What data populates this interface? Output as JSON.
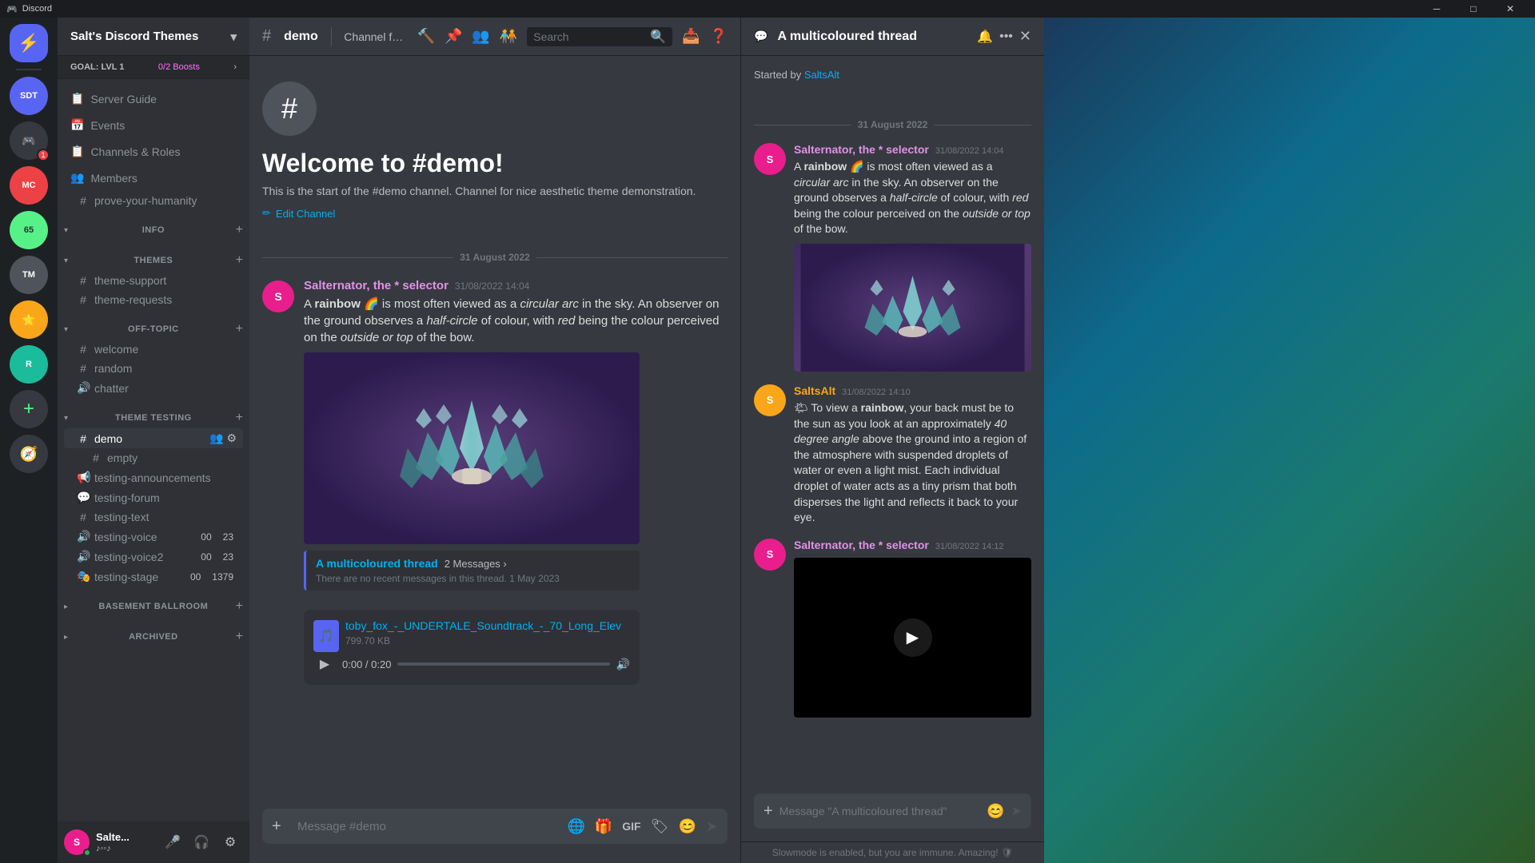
{
  "titlebar": {
    "app_name": "Discord",
    "controls": [
      "minimize",
      "maximize",
      "close"
    ]
  },
  "server": {
    "name": "Salt's Discord Themes",
    "boost_goal": "GOAL: LVL 1",
    "boost_count": "0/2 Boosts"
  },
  "sidebar": {
    "nav_items": [
      {
        "id": "server-guide",
        "icon": "📋",
        "label": "Server Guide"
      },
      {
        "id": "events",
        "icon": "📅",
        "label": "Events"
      },
      {
        "id": "channels-roles",
        "icon": "📋",
        "label": "Channels & Roles"
      },
      {
        "id": "members",
        "icon": "👥",
        "label": "Members"
      }
    ],
    "special_channels": [
      {
        "id": "prove-humanity",
        "icon": "#",
        "label": "prove-your-humanity",
        "type": "text"
      }
    ],
    "categories": [
      {
        "id": "info",
        "name": "INFO",
        "collapsed": false,
        "channels": []
      },
      {
        "id": "themes",
        "name": "THEMES",
        "collapsed": false,
        "channels": [
          {
            "id": "theme-support",
            "icon": "#",
            "label": "theme-support",
            "type": "text"
          },
          {
            "id": "theme-requests",
            "icon": "#",
            "label": "theme-requests",
            "type": "text"
          }
        ]
      },
      {
        "id": "off-topic",
        "name": "OFF-TOPIC",
        "collapsed": false,
        "channels": [
          {
            "id": "welcome",
            "icon": "#",
            "label": "welcome",
            "type": "text"
          },
          {
            "id": "random",
            "icon": "#",
            "label": "random",
            "type": "text"
          },
          {
            "id": "chatter",
            "icon": "🔊",
            "label": "chatter",
            "type": "voice"
          }
        ]
      },
      {
        "id": "theme-testing",
        "name": "THEME TESTING",
        "collapsed": false,
        "channels": [
          {
            "id": "demo",
            "icon": "#",
            "label": "demo",
            "type": "text",
            "active": true
          },
          {
            "id": "empty",
            "icon": "#",
            "label": "empty",
            "type": "text"
          },
          {
            "id": "testing-announcements",
            "icon": "📢",
            "label": "testing-announcements",
            "type": "announcement"
          },
          {
            "id": "testing-forum",
            "icon": "💬",
            "label": "testing-forum",
            "type": "forum"
          },
          {
            "id": "testing-text",
            "icon": "#",
            "label": "testing-text",
            "type": "text"
          },
          {
            "id": "testing-voice",
            "icon": "🔊",
            "label": "testing-voice",
            "type": "voice",
            "count1": "00",
            "count2": "23"
          },
          {
            "id": "testing-voice2",
            "icon": "🔊",
            "label": "testing-voice2",
            "type": "voice",
            "count1": "00",
            "count2": "23"
          },
          {
            "id": "testing-stage",
            "icon": "🎭",
            "label": "testing-stage",
            "type": "stage",
            "count1": "00",
            "count2": "1379"
          }
        ]
      },
      {
        "id": "basement-ballroom",
        "name": "BASEMENT BALLROOM",
        "collapsed": false,
        "channels": []
      },
      {
        "id": "archived",
        "name": "ARCHIVED",
        "collapsed": false,
        "channels": []
      }
    ]
  },
  "current_channel": {
    "name": "demo",
    "topic": "Channel for nice aesthe...",
    "welcome_title": "Welcome to #demo!",
    "welcome_desc": "This is the start of the #demo channel. Channel for nice aesthetic theme demonstration.",
    "edit_channel": "Edit Channel"
  },
  "messages": [
    {
      "id": "msg1",
      "author": "Salternator, the * selector",
      "author_color": "purple",
      "timestamp": "31/08/2022 14:04",
      "avatar_initials": "S",
      "avatar_color": "pink",
      "text_parts": [
        {
          "type": "text",
          "content": "A "
        },
        {
          "type": "bold",
          "content": "rainbow"
        },
        {
          "type": "text",
          "content": " 🌈 is most often viewed as a "
        },
        {
          "type": "italic",
          "content": "circular arc"
        },
        {
          "type": "text",
          "content": " in the sky. An observer on the ground observes a "
        },
        {
          "type": "italic",
          "content": "half-circle"
        },
        {
          "type": "text",
          "content": " of colour, with "
        },
        {
          "type": "italic",
          "content": "red"
        },
        {
          "type": "text",
          "content": " being the colour perceived on the "
        },
        {
          "type": "italic",
          "content": "outside or top"
        },
        {
          "type": "text",
          "content": " of the bow."
        }
      ],
      "has_image": true,
      "has_thread": true,
      "thread_name": "A multicoloured thread",
      "thread_messages": "2 Messages ›",
      "thread_last": "There are no recent messages in this thread. 1 May 2023"
    },
    {
      "id": "msg2",
      "author": "Salternator, the * selector",
      "author_color": "purple",
      "timestamp": "31/08/2022 14:04",
      "is_continuation": true,
      "has_audio": true,
      "audio_filename": "toby_fox_-_UNDERTALE_Soundtrack_-_70_Long_Elev",
      "audio_filesize": "799.70 KB",
      "audio_time": "0:00 / 0:20"
    }
  ],
  "input": {
    "placeholder": "Message #demo",
    "thread_placeholder": "Message \"A multicoloured thread\""
  },
  "user": {
    "name": "Salte...",
    "discriminator": "♪◦◦♪",
    "avatar_initials": "S",
    "avatar_color": "pink"
  },
  "thread_panel": {
    "title": "A multicoloured thread",
    "started_by": "Started by",
    "started_by_user": "SaltsAlt",
    "date": "31 August 2022",
    "messages": [
      {
        "id": "tm1",
        "author": "Salternator, the * selector",
        "author_color": "purple",
        "timestamp": "31/08/2022 14:04",
        "avatar_initials": "S",
        "avatar_color": "pink",
        "text": "A rainbow 🌈 is most often viewed as a circular arc in the sky. An observer on the ground observes a half-circle of colour, with red being the colour perceived on the outside or top of the bow.",
        "has_image": true
      },
      {
        "id": "tm2",
        "author": "SaltsAlt",
        "author_color": "yellow",
        "timestamp": "31/08/2022 14:10",
        "avatar_initials": "S",
        "avatar_color": "yellow",
        "text": "🌤 To view a rainbow, your back must be to the sun as you look at an approximately 40 degree angle above the ground into a region of the atmosphere with suspended droplets of water or even a light mist. Each individual droplet of water acts as a tiny prism that both disperses the light and reflects it back to your eye."
      },
      {
        "id": "tm3",
        "author": "Salternator, the * selector",
        "author_color": "purple",
        "timestamp": "31/08/2022 14:12",
        "avatar_initials": "S",
        "avatar_color": "pink",
        "has_video": true
      }
    ],
    "slowmode": "Slowmode is enabled, but you are immune. Amazing! 🛡"
  },
  "date_divider": "31 August 2022",
  "colors": {
    "accent": "#5865f2",
    "brand": "#5865f2",
    "background": "#36393f",
    "sidebar_bg": "#2f3136",
    "header_bg": "#36393f"
  }
}
